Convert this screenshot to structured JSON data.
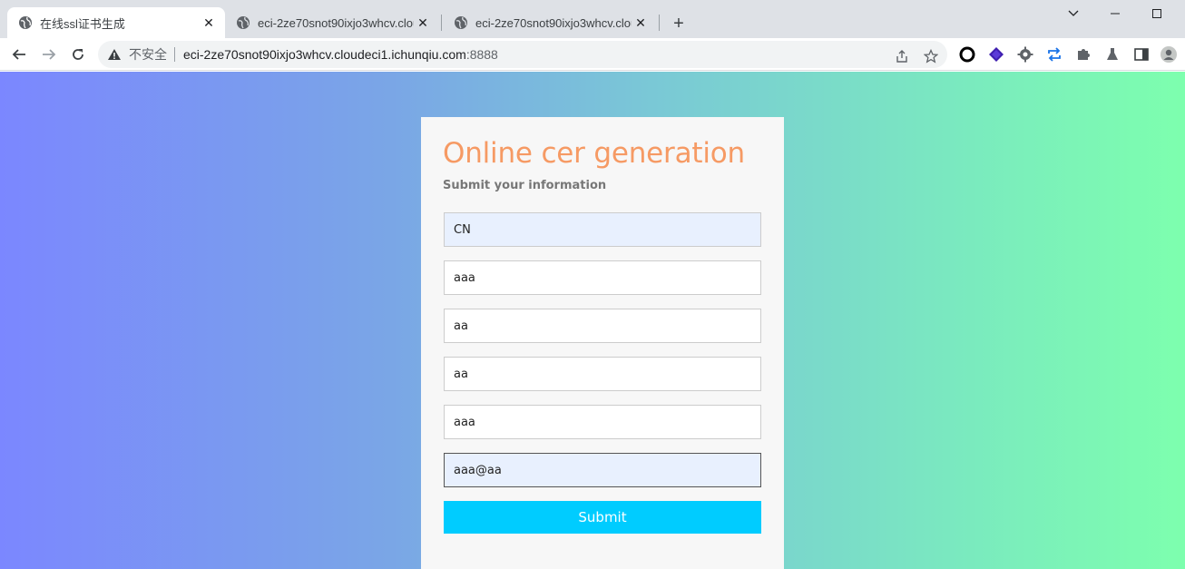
{
  "tabs": [
    {
      "title": "在线ssl证书生成",
      "active": true
    },
    {
      "title": "eci-2ze70snot90ixjo3whcv.clou",
      "active": false
    },
    {
      "title": "eci-2ze70snot90ixjo3whcv.clou",
      "active": false
    }
  ],
  "toolbar": {
    "security_label": "不安全",
    "url_host": "eci-2ze70snot90ixjo3whcv.cloudeci1.ichunqiu.com",
    "url_port": ":8888"
  },
  "form": {
    "title": "Online cer generation",
    "subtitle": "Submit your information",
    "fields": [
      {
        "value": "CN"
      },
      {
        "value": "aaa"
      },
      {
        "value": "aa"
      },
      {
        "value": "aa"
      },
      {
        "value": "aaa"
      },
      {
        "value": "aaa@aa"
      }
    ],
    "submit_label": "Submit"
  },
  "colors": {
    "title": "#f69a64",
    "submit": "#00ccff",
    "gradient_left": "#7b87ff",
    "gradient_right": "#7dffae"
  }
}
